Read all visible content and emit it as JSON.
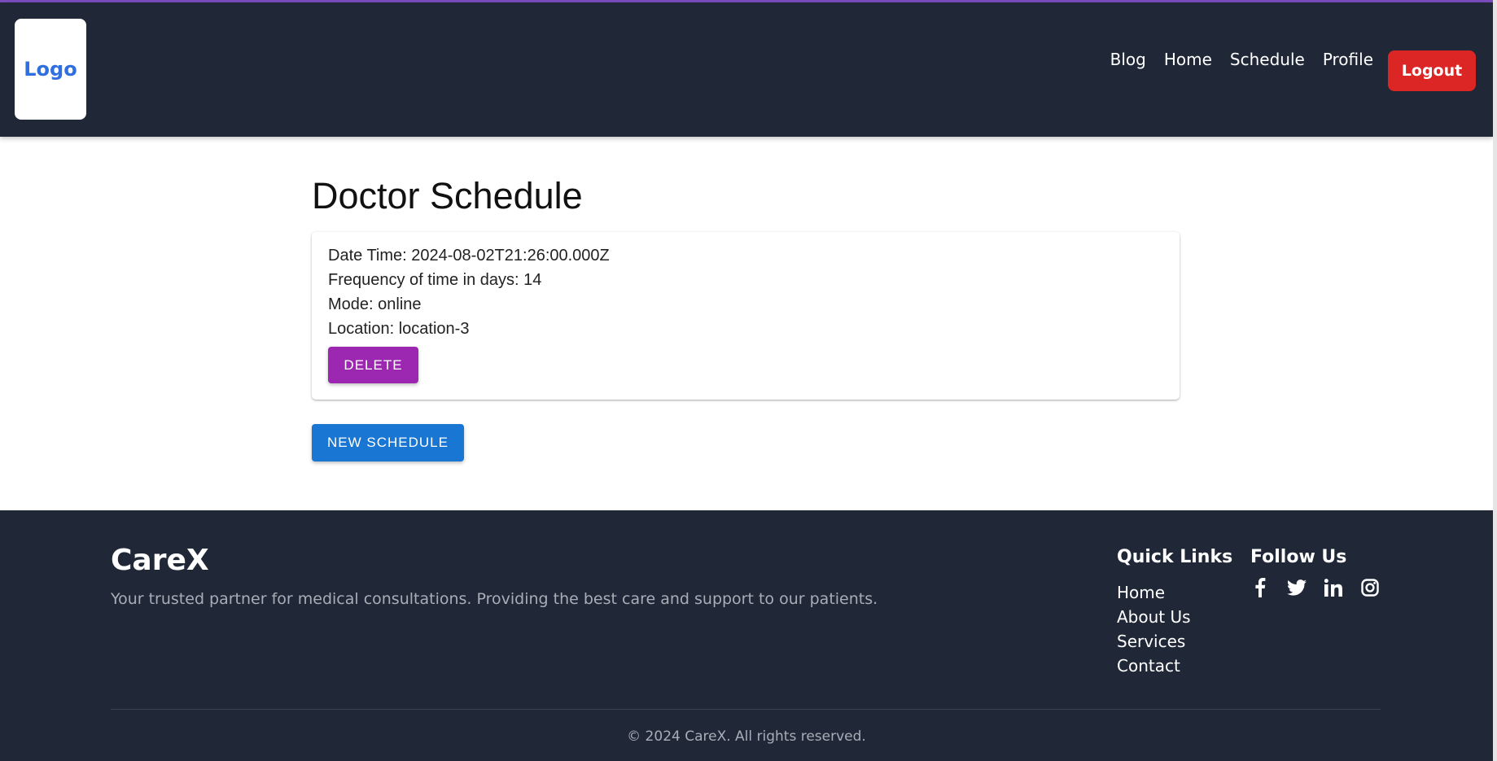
{
  "header": {
    "logo_text": "Logo",
    "nav": [
      "Blog",
      "Home",
      "Schedule",
      "Profile"
    ],
    "logout_label": "Logout"
  },
  "main": {
    "title": "Doctor Schedule",
    "schedule": {
      "datetime": "Date Time: 2024-08-02T21:26:00.000Z",
      "frequency": "Frequency of time in days: 14",
      "mode": "Mode: online",
      "location": "Location: location-3",
      "delete_label": "DELETE"
    },
    "new_schedule_label": "NEW SCHEDULE"
  },
  "footer": {
    "brand": "CareX",
    "tagline": "Your trusted partner for medical consultations. Providing the best care and support to our patients.",
    "quick_links_title": "Quick Links",
    "quick_links": [
      "Home",
      "About Us",
      "Services",
      "Contact"
    ],
    "follow_title": "Follow Us",
    "socials": [
      "facebook-icon",
      "twitter-icon",
      "linkedin-icon",
      "instagram-icon"
    ],
    "copyright": "© 2024 CareX. All rights reserved."
  },
  "colors": {
    "header_bg": "#202838",
    "logout": "#dc2626",
    "delete": "#9c27b0",
    "primary": "#1976d2",
    "accent": "#7c4dbf"
  }
}
